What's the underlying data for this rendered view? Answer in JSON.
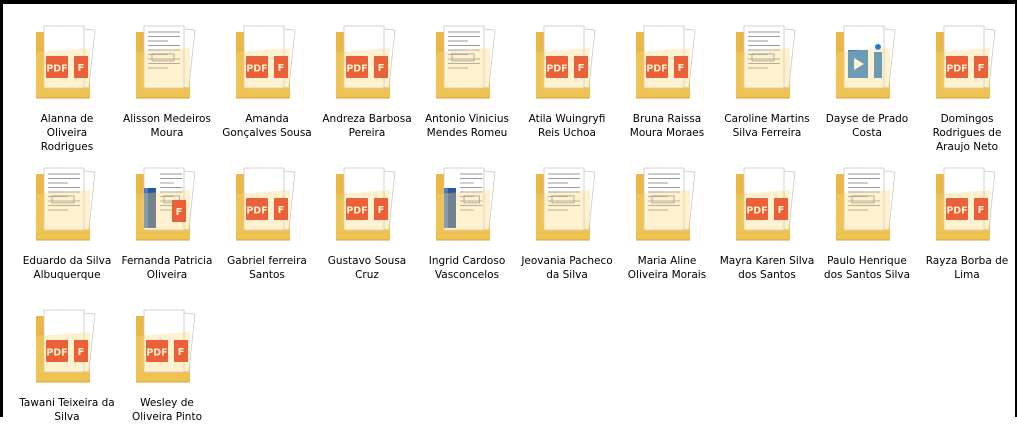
{
  "folders": [
    {
      "name": "Alanna de Oliveira Rodrigues",
      "preview": "pdf-icon"
    },
    {
      "name": "Alisson Medeiros Moura",
      "preview": "document-page-icon"
    },
    {
      "name": "Amanda Gonçalves Sousa",
      "preview": "pdf-icon"
    },
    {
      "name": "Andreza Barbosa Pereira",
      "preview": "pdf-icon"
    },
    {
      "name": "Antonio Vinicius Mendes Romeu",
      "preview": "document-page-icon"
    },
    {
      "name": "Atila Wuingryfi Reis Uchoa",
      "preview": "pdf-icon"
    },
    {
      "name": "Bruna Raissa Moura Moraes",
      "preview": "pdf-icon"
    },
    {
      "name": "Caroline Martins Silva Ferreira",
      "preview": "document-page-icon"
    },
    {
      "name": "Dayse de Prado Costa",
      "preview": "image-file-icon"
    },
    {
      "name": "Domingos Rodrigues de Araujo Neto",
      "preview": "pdf-icon"
    },
    {
      "name": "Eduardo da Silva Albuquerque",
      "preview": "document-page-icon"
    },
    {
      "name": "Fernanda Patricia Oliveira",
      "preview": "word-pdf-icon"
    },
    {
      "name": "Gabriel ferreira Santos",
      "preview": "pdf-icon"
    },
    {
      "name": "Gustavo Sousa Cruz",
      "preview": "pdf-icon"
    },
    {
      "name": "Ingrid Cardoso Vasconcelos",
      "preview": "word-document-icon"
    },
    {
      "name": "Jeovania Pacheco da Silva",
      "preview": "document-page-icon"
    },
    {
      "name": "Maria Aline Oliveira Morais",
      "preview": "document-page-icon"
    },
    {
      "name": "Mayra Karen Silva dos Santos",
      "preview": "pdf-icon"
    },
    {
      "name": "Paulo Henrique dos Santos Silva",
      "preview": "document-page-icon"
    },
    {
      "name": "Rayza Borba de Lima",
      "preview": "pdf-icon"
    },
    {
      "name": "Tawani Teixeira da Silva",
      "preview": "pdf-icon"
    },
    {
      "name": "Wesley de Oliveira Pinto",
      "preview": "pdf-icon"
    }
  ],
  "colors": {
    "folder_back": "#e8b842",
    "folder_front": "#f8d775",
    "pdf_red": "#e2231a",
    "word_blue": "#2b579a",
    "image_blue": "#1f7bd8"
  }
}
